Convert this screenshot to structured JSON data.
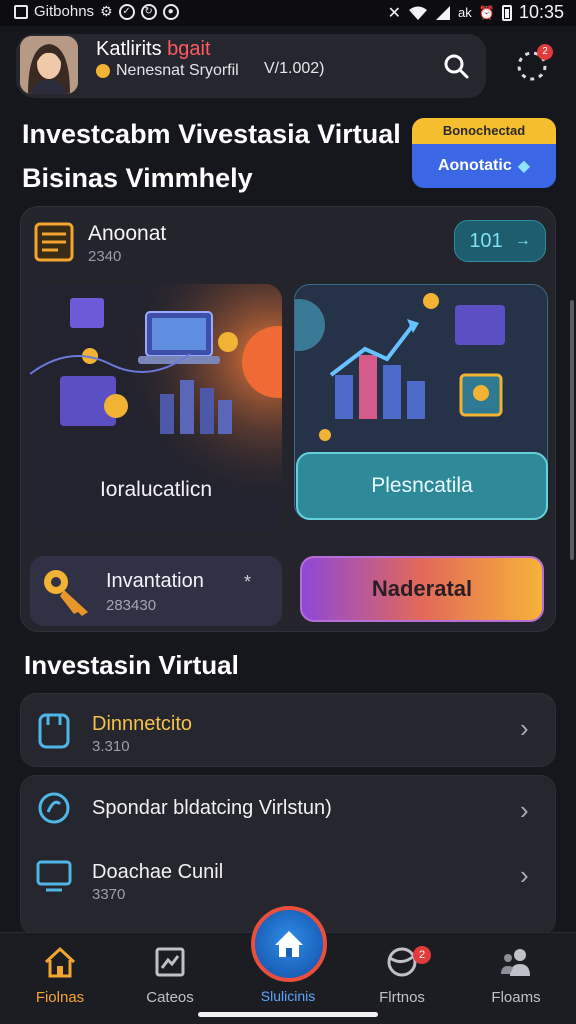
{
  "status_bar": {
    "app_label": "Gitbohns",
    "icons": [
      "square-icon",
      "settings-dot-icon",
      "check-dot-icon",
      "refresh-dot-icon"
    ],
    "right_icons": [
      "mute-icon",
      "wifi-icon",
      "signal-icon",
      "battery-icon"
    ],
    "network_text": "ak",
    "time": "10:35"
  },
  "header": {
    "name": "Katlirits",
    "name_accent": "bgait",
    "subtitle": "Nenesnat Sryorfil",
    "version": "V/1.002)",
    "notification_count": "2"
  },
  "page": {
    "title_line1": "Investcabm Vivestasia Virtual",
    "title_line2": "Bisinas Vimmhely"
  },
  "promo": {
    "top_label": "Bonochectad",
    "button_label": "Aonotatic"
  },
  "account": {
    "title": "Anoonat",
    "number": "2340",
    "pill_value": "101"
  },
  "tiles": {
    "left_label": "Ioralucatlicn",
    "right_label": "Plesncatila"
  },
  "investment": {
    "title": "Invantation",
    "star": "*",
    "number": "283430",
    "action_label": "Naderatal"
  },
  "section": {
    "title": "Investasin Virtual",
    "rows": [
      {
        "title": "Dinnnetcito",
        "sub": "3.310"
      },
      {
        "title": "Spondar bldatcing Virlstun)",
        "sub": ""
      },
      {
        "title": "Doachae Cunil",
        "sub": "3370"
      }
    ]
  },
  "nav": {
    "items": [
      {
        "label": "Fiolnas"
      },
      {
        "label": "Cateos"
      },
      {
        "label": "Slulicinis"
      },
      {
        "label": "Flrtnos"
      },
      {
        "label": "Floams"
      }
    ],
    "badge": "2"
  },
  "colors": {
    "background": "#16171c",
    "card": "#25262e",
    "accent_orange": "#f4a531",
    "accent_blue": "#3b67e6",
    "accent_teal": "#2e8a98",
    "badge_red": "#e33b3b"
  }
}
